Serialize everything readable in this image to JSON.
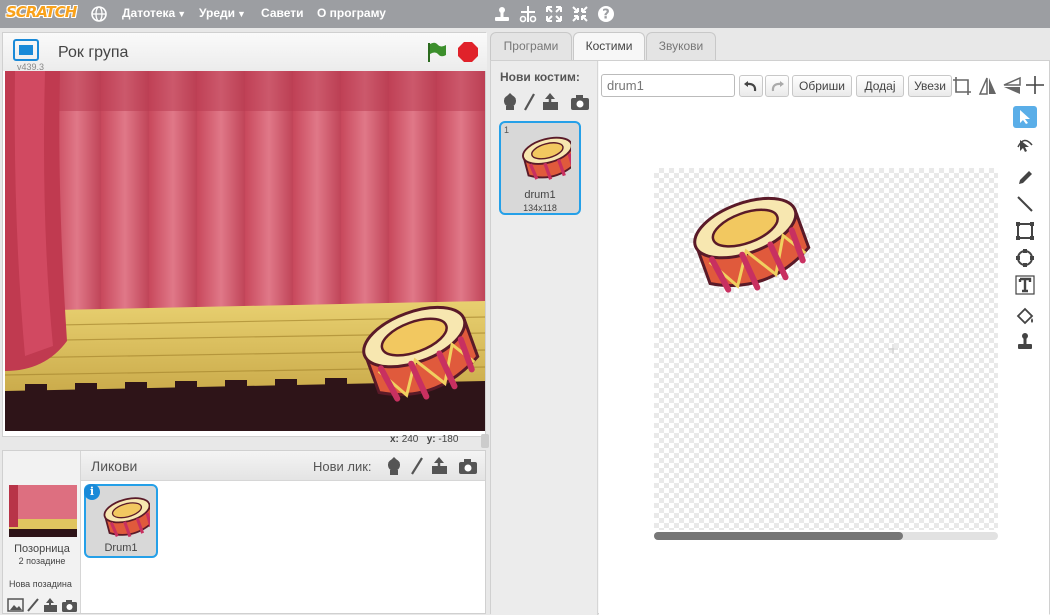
{
  "menu": {
    "logo": "SCRATCH",
    "file": "Датотека",
    "edit": "Уреди",
    "tips": "Савети",
    "about": "О програму"
  },
  "stage": {
    "title": "Рок група",
    "version": "v439.3",
    "x_label": "x:",
    "x_value": "240",
    "y_label": "y:",
    "y_value": "-180"
  },
  "sprites": {
    "header": "Ликови",
    "new_sprite": "Нови лик:",
    "stage_label": "Позорница",
    "backdrop_count": "2 позадине",
    "new_backdrop": "Нова позадина",
    "items": [
      {
        "name": "Drum1"
      }
    ]
  },
  "tabs": [
    {
      "label": "Програми"
    },
    {
      "label": "Костими"
    },
    {
      "label": "Звукови"
    }
  ],
  "costumes": {
    "new_costume": "Нови костим:",
    "items": [
      {
        "index": "1",
        "name": "drum1",
        "size": "134x118"
      }
    ]
  },
  "paint": {
    "name_value": "drum1",
    "clear": "Обриши",
    "add": "Додај",
    "import": "Увези"
  },
  "colors": {
    "accent": "#25a0e8",
    "menubar": "#9c9ea2",
    "green_flag": "#3c8f2c",
    "stop": "#e0222a"
  }
}
